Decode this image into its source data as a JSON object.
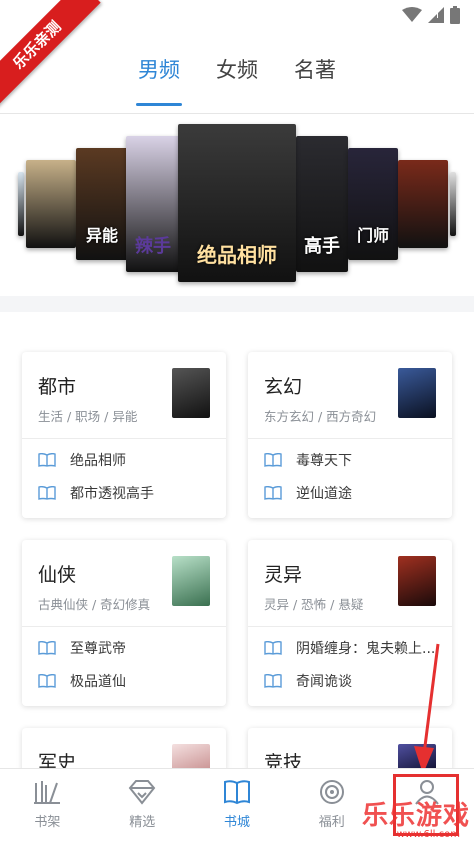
{
  "watermark": {
    "ribbon": "乐乐亲测",
    "brand": "乐乐游戏",
    "url": "www.6ll.com"
  },
  "top_tabs": [
    {
      "label": "男频",
      "active": true
    },
    {
      "label": "女频",
      "active": false
    },
    {
      "label": "名著",
      "active": false
    }
  ],
  "carousel": {
    "covers": [
      {
        "title": "",
        "color": "#d7e4ee"
      },
      {
        "title": "",
        "color": "#c7b189"
      },
      {
        "title": "异能",
        "color": "#5b3a22"
      },
      {
        "title": "辣手",
        "color": "#d9d2e6"
      },
      {
        "title": "绝品相师",
        "color": "#3b3b3b"
      },
      {
        "title": "高手",
        "color": "#2b2b30"
      },
      {
        "title": "门师",
        "color": "#28253a"
      },
      {
        "title": "",
        "color": "#7a2a1a"
      },
      {
        "title": "",
        "color": "#e0e0e0"
      }
    ]
  },
  "categories": [
    {
      "title": "都市",
      "sub": "生活 / 职场 / 异能",
      "thumb_color": "#2a2a2a",
      "books": [
        "绝品相师",
        "都市透视高手"
      ]
    },
    {
      "title": "玄幻",
      "sub": "东方玄幻 / 西方奇幻",
      "thumb_color": "#1b2a4a",
      "books": [
        "毒尊天下",
        "逆仙道途"
      ]
    },
    {
      "title": "仙侠",
      "sub": "古典仙侠 / 奇幻修真",
      "thumb_color": "#6aa080",
      "books": [
        "至尊武帝",
        "极品道仙"
      ]
    },
    {
      "title": "灵异",
      "sub": "灵异 / 恐怖 / 悬疑",
      "thumb_color": "#3a1a1a",
      "books": [
        "阴婚缠身：鬼夫赖上...",
        "奇闻诡谈"
      ]
    },
    {
      "title": "军史",
      "sub": "",
      "thumb_color": "#e8c8c8",
      "books": []
    },
    {
      "title": "竞技",
      "sub": "",
      "thumb_color": "#2a2a5a",
      "books": []
    }
  ],
  "bottom_nav": [
    {
      "label": "书架",
      "icon": "bookshelf-icon",
      "active": false
    },
    {
      "label": "精选",
      "icon": "diamond-icon",
      "active": false
    },
    {
      "label": "书城",
      "icon": "book-open-icon",
      "active": true
    },
    {
      "label": "福利",
      "icon": "target-icon",
      "active": false
    },
    {
      "label": "",
      "icon": "person-icon",
      "active": false
    }
  ],
  "colors": {
    "accent": "#2f86d6",
    "annotation": "#e53030"
  }
}
